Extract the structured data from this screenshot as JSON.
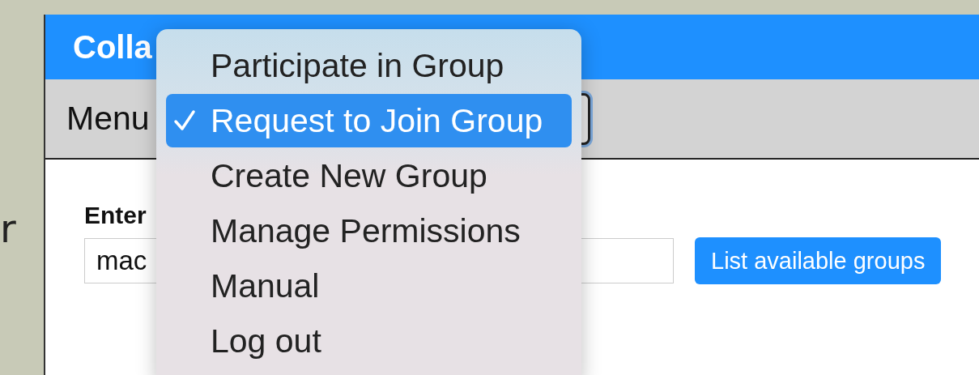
{
  "side_text": "r",
  "window": {
    "title": "Colla"
  },
  "toolbar": {
    "label": "Menu"
  },
  "menu": {
    "items": [
      {
        "label": "Participate in Group",
        "selected": false
      },
      {
        "label": "Request to Join Group",
        "selected": true
      },
      {
        "label": "Create New Group",
        "selected": false
      },
      {
        "label": "Manage Permissions",
        "selected": false
      },
      {
        "label": "Manual",
        "selected": false
      },
      {
        "label": "Log out",
        "selected": false
      }
    ]
  },
  "form": {
    "label": "Enter",
    "value": "mac",
    "button": "List available groups"
  }
}
